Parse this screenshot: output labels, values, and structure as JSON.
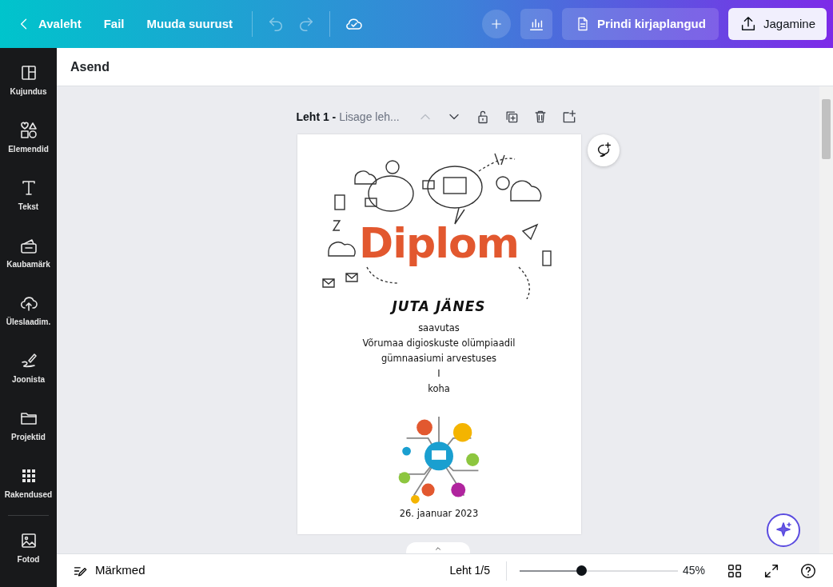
{
  "topbar": {
    "back": "Avaleht",
    "menus": [
      "Fail",
      "Muuda suurust"
    ],
    "history": [
      {
        "kind": "undo",
        "disabled": true
      },
      {
        "kind": "redo",
        "disabled": true
      }
    ],
    "print": "Prindi kirjaplangud",
    "share": "Jagamine"
  },
  "sidebar": {
    "items": [
      {
        "kind": "layout",
        "label": "Kujundus"
      },
      {
        "kind": "shapes",
        "label": "Elemendid"
      },
      {
        "kind": "text",
        "label": "Tekst"
      },
      {
        "kind": "brand",
        "label": "Kaubamärk"
      },
      {
        "kind": "upload",
        "label": "Üleslaadim."
      },
      {
        "kind": "draw",
        "label": "Joonista"
      },
      {
        "kind": "folder",
        "label": "Projektid"
      },
      {
        "kind": "apps",
        "label": "Rakendused"
      },
      {
        "kind": "photo",
        "label": "Fotod"
      }
    ]
  },
  "toolbar": {
    "label": "Asend"
  },
  "page_header": {
    "page": "Leht 1 -",
    "title_placeholder": "Lisage leh..."
  },
  "diploma": {
    "title": "Diplom",
    "name": "JUTA JÄNES",
    "lines": [
      "saavutas",
      "Võrumaa digioskuste olümpiaadil",
      "gümnaasiumi arvestuses",
      "I",
      "koha"
    ],
    "date": "26. jaanuar 2023"
  },
  "footer": {
    "notes": "Märkmed",
    "page_count": "Leht 1/5",
    "zoom": {
      "level": 0.39
    },
    "zoom_reading": "45%"
  }
}
